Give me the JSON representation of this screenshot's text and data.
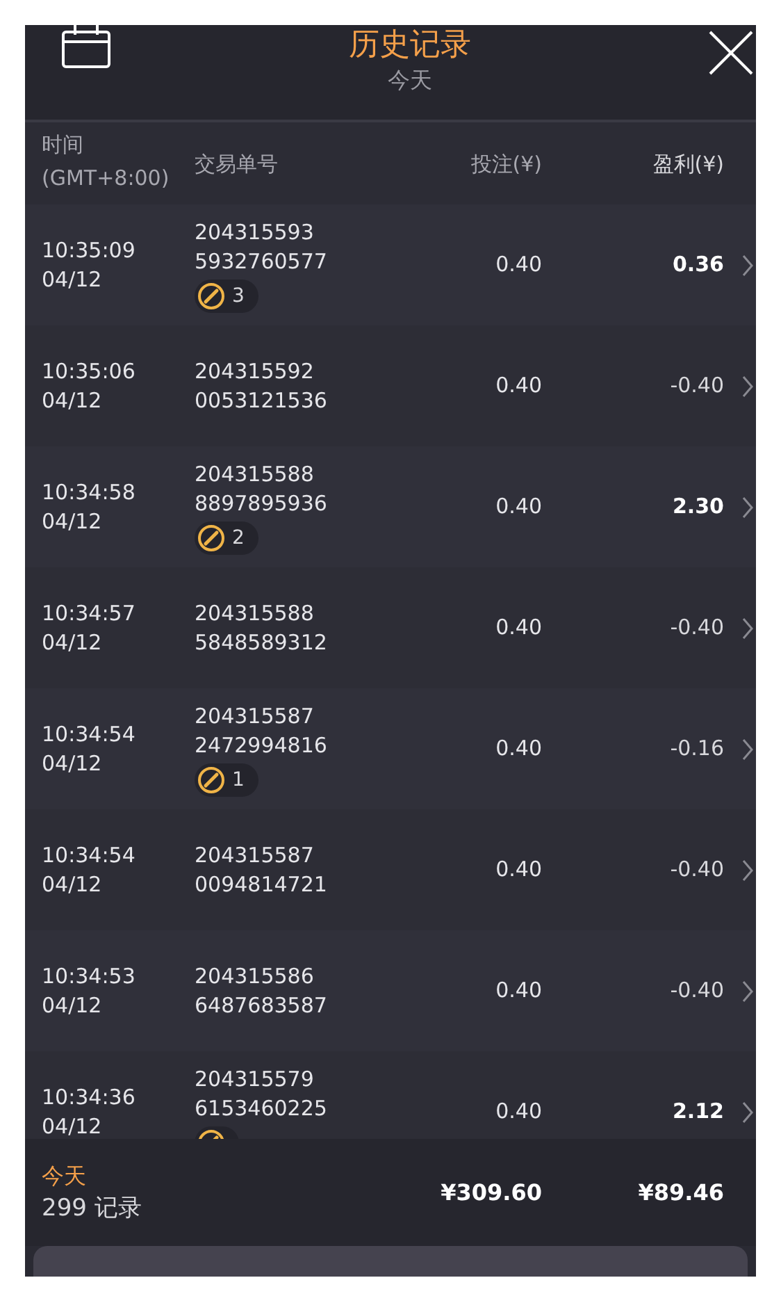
{
  "header": {
    "title": "历史记录",
    "subtitle": "今天"
  },
  "columns": [
    {
      "line1": "时间",
      "line2": "(GMT+8:00)"
    },
    {
      "line1": "交易单号"
    },
    {
      "line1": "投注(¥)"
    },
    {
      "line1": "盈利(¥)"
    }
  ],
  "rows": [
    {
      "time": "10:35:09",
      "date": "04/12",
      "order": [
        "204315593",
        "5932760577"
      ],
      "badge": {
        "count": "3"
      },
      "stake": "0.40",
      "profit": "0.36",
      "win": true
    },
    {
      "time": "10:35:06",
      "date": "04/12",
      "order": [
        "204315592",
        "0053121536"
      ],
      "stake": "0.40",
      "profit": "-0.40",
      "win": false
    },
    {
      "time": "10:34:58",
      "date": "04/12",
      "order": [
        "204315588",
        "8897895936"
      ],
      "badge": {
        "count": "2"
      },
      "stake": "0.40",
      "profit": "2.30",
      "win": true
    },
    {
      "time": "10:34:57",
      "date": "04/12",
      "order": [
        "204315588",
        "5848589312"
      ],
      "stake": "0.40",
      "profit": "-0.40",
      "win": false
    },
    {
      "time": "10:34:54",
      "date": "04/12",
      "order": [
        "204315587",
        "2472994816"
      ],
      "badge": {
        "count": "1"
      },
      "stake": "0.40",
      "profit": "-0.16",
      "win": false
    },
    {
      "time": "10:34:54",
      "date": "04/12",
      "order": [
        "204315587",
        "0094814721"
      ],
      "stake": "0.40",
      "profit": "-0.40",
      "win": false
    },
    {
      "time": "10:34:53",
      "date": "04/12",
      "order": [
        "204315586",
        "6487683587"
      ],
      "stake": "0.40",
      "profit": "-0.40",
      "win": false
    },
    {
      "time": "10:34:36",
      "date": "04/12",
      "order": [
        "204315579",
        "6153460225"
      ],
      "badge": {},
      "stake": "0.40",
      "profit": "2.12",
      "win": true
    }
  ],
  "footer": {
    "period": "今天",
    "records": "299 记录",
    "total_stake": "¥309.60",
    "total_profit": "¥89.46"
  }
}
